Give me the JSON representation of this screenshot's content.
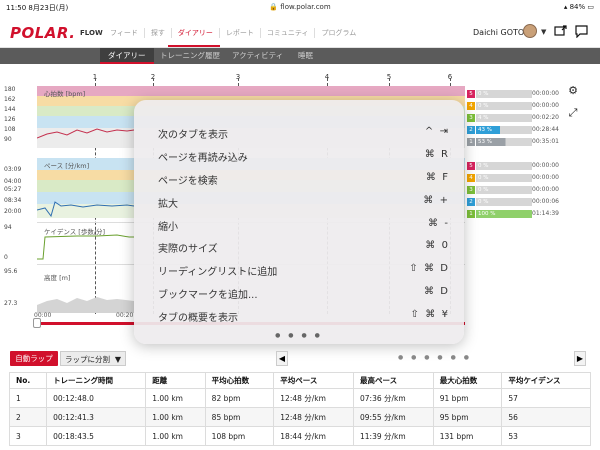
{
  "statusbar": {
    "time": "11:50",
    "date": "8月23日(月)",
    "url": "flow.polar.com",
    "battery": "84%"
  },
  "topnav": {
    "logo": "POLAR.",
    "flow": "FLOW",
    "links": [
      "フィード",
      "探す",
      "ダイアリー",
      "レポート",
      "コミュニティ",
      "プログラム"
    ],
    "active_link": "ダイアリー",
    "user_name": "Daichi GOTO"
  },
  "subnav": {
    "items": [
      "ダイアリー",
      "トレーニング履歴",
      "アクティビティ",
      "睡眠"
    ],
    "active": "ダイアリー"
  },
  "chart": {
    "laps": [
      "1",
      "2",
      "3",
      "4",
      "5",
      "6"
    ],
    "hr_label": "心拍数 [bpm]",
    "hr_ticks": [
      "180",
      "162",
      "144",
      "126",
      "108",
      "90"
    ],
    "pace_label": "ペース [分/km]",
    "pace_ticks": [
      "03:09",
      "04:00",
      "05:27",
      "08:34",
      "20:00"
    ],
    "cadence_label": "ケイデンス [歩数/分]",
    "cadence_ticks": [
      "94",
      "0"
    ],
    "altitude_label": "高度 [m]",
    "altitude_ticks": [
      "95.6",
      "27.3"
    ],
    "time_labels": [
      "00:00",
      "00:20"
    ],
    "hr_zones": [
      {
        "zone": "5",
        "percent": "0 %",
        "time": "00:00:00",
        "color": "#d7245f"
      },
      {
        "zone": "4",
        "percent": "0 %",
        "time": "00:00:00",
        "color": "#f2a500"
      },
      {
        "zone": "3",
        "percent": "4 %",
        "time": "00:02:20",
        "color": "#7cbf3a"
      },
      {
        "zone": "2",
        "percent": "43 %",
        "time": "00:28:44",
        "color": "#2f9fd8"
      },
      {
        "zone": "1",
        "percent": "53 %",
        "time": "00:35:01",
        "color": "#9aa0a6"
      }
    ],
    "pace_zones": [
      {
        "zone": "5",
        "percent": "0 %",
        "time": "00:00:00",
        "color": "#d7245f"
      },
      {
        "zone": "4",
        "percent": "0 %",
        "time": "00:00:00",
        "color": "#f2a500"
      },
      {
        "zone": "3",
        "percent": "0 %",
        "time": "00:00:00",
        "color": "#7cbf3a"
      },
      {
        "zone": "2",
        "percent": "0 %",
        "time": "00:00:06",
        "color": "#2f9fd8"
      },
      {
        "zone": "1",
        "percent": "100 %",
        "time": "01:14:39",
        "color": "#7cbf3a"
      }
    ]
  },
  "context_menu": {
    "items": [
      {
        "label": "次のタブを表示",
        "keys": "^  ⇥"
      },
      {
        "label": "ページを再読み込み",
        "keys": "⌘  R"
      },
      {
        "label": "ページを検索",
        "keys": "⌘  F"
      },
      {
        "label": "拡大",
        "keys": "⌘  +"
      },
      {
        "label": "縮小",
        "keys": "⌘  -"
      },
      {
        "label": "実際のサイズ",
        "keys": "⌘  0"
      },
      {
        "label": "リーディングリストに追加",
        "keys": "⇧  ⌘  D"
      },
      {
        "label": "ブックマークを追加...",
        "keys": "⌘  D"
      },
      {
        "label": "タブの概要を表示",
        "keys": "⇧  ⌘  ¥"
      }
    ],
    "page_dots": "● ● ● ●"
  },
  "laps_controls": {
    "auto_lap": "自動ラップ",
    "lap_split": "ラップに分割",
    "pager_dots": "● ● ● ● ● ●"
  },
  "table": {
    "headers": [
      "No.",
      "トレーニング時間",
      "距離",
      "平均心拍数",
      "平均ペース",
      "最高ペース",
      "最大心拍数",
      "平均ケイデンス"
    ],
    "rows": [
      [
        "1",
        "00:12:48.0",
        "1.00 km",
        "82 bpm",
        "12:48 分/km",
        "07:36 分/km",
        "91 bpm",
        "57"
      ],
      [
        "2",
        "00:12:41.3",
        "1.00 km",
        "85 bpm",
        "12:48 分/km",
        "09:55 分/km",
        "95 bpm",
        "56"
      ],
      [
        "3",
        "00:18:43.5",
        "1.00 km",
        "108 bpm",
        "18:44 分/km",
        "11:39 分/km",
        "131 bpm",
        "53"
      ]
    ]
  }
}
